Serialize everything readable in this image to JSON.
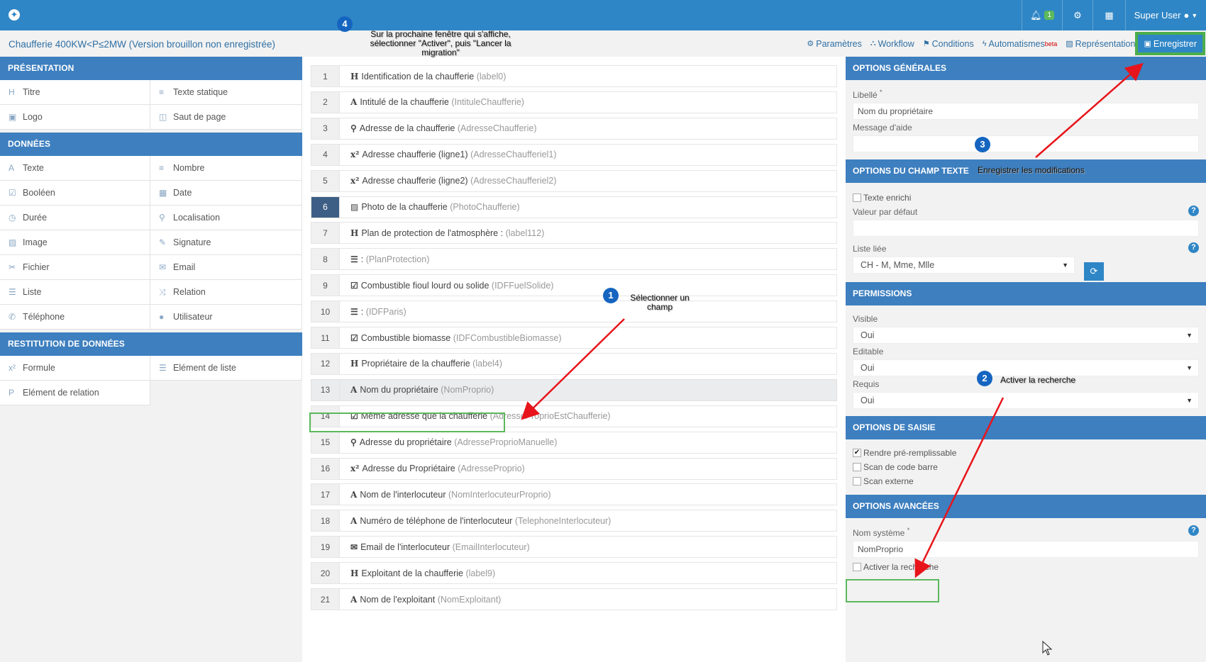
{
  "topbar": {
    "notification_count": "1",
    "user_label": "Super User"
  },
  "header": {
    "form_title": "Chaufferie 400KW<P≤2MW (Version brouillon non enregistrée)",
    "toolbar": {
      "parametres": "Paramètres",
      "workflow": "Workflow",
      "conditions": "Conditions",
      "automatismes": "Automatismes",
      "beta": "beta",
      "representation": "Représentation",
      "save": "Enregistrer"
    }
  },
  "left": {
    "presentation": {
      "title": "PRÉSENTATION",
      "items": [
        {
          "icon": "H",
          "label": "Titre"
        },
        {
          "icon": "≡",
          "label": "Texte statique"
        },
        {
          "icon": "▣",
          "label": "Logo"
        },
        {
          "icon": "◫",
          "label": "Saut de page"
        }
      ]
    },
    "donnees": {
      "title": "DONNÉES",
      "items": [
        {
          "icon": "A",
          "label": "Texte"
        },
        {
          "icon": "≡",
          "label": "Nombre"
        },
        {
          "icon": "☑",
          "label": "Booléen"
        },
        {
          "icon": "▦",
          "label": "Date"
        },
        {
          "icon": "◷",
          "label": "Durée"
        },
        {
          "icon": "⚲",
          "label": "Localisation"
        },
        {
          "icon": "▨",
          "label": "Image"
        },
        {
          "icon": "✎",
          "label": "Signature"
        },
        {
          "icon": "✂",
          "label": "Fichier"
        },
        {
          "icon": "✉",
          "label": "Email"
        },
        {
          "icon": "☰",
          "label": "Liste"
        },
        {
          "icon": "⤨",
          "label": "Relation"
        },
        {
          "icon": "✆",
          "label": "Téléphone"
        },
        {
          "icon": "●",
          "label": "Utilisateur"
        }
      ]
    },
    "restitution": {
      "title": "RESTITUTION DE DONNÉES",
      "items": [
        {
          "icon": "x²",
          "label": "Formule"
        },
        {
          "icon": "☰",
          "label": "Elément de liste"
        },
        {
          "icon": "P",
          "label": "Elément de relation"
        }
      ]
    }
  },
  "fields": [
    {
      "num": "1",
      "icon": "H",
      "label": "Identification de la chaufferie",
      "sys": "(label0)"
    },
    {
      "num": "2",
      "icon": "A",
      "label": "Intitulé de la chaufferie",
      "sys": "(IntituleChaufferie)"
    },
    {
      "num": "3",
      "icon": "⚲",
      "label": "Adresse de la chaufferie",
      "sys": "(AdresseChaufferie)"
    },
    {
      "num": "4",
      "icon": "x²",
      "label": "Adresse chaufferie (ligne1)",
      "sys": "(AdresseChaufferiel1)"
    },
    {
      "num": "5",
      "icon": "x²",
      "label": "Adresse chaufferie (ligne2)",
      "sys": "(AdresseChaufferiel2)"
    },
    {
      "num": "6",
      "icon": "▨",
      "label": "Photo de la chaufferie",
      "sys": "(PhotoChaufferie)"
    },
    {
      "num": "7",
      "icon": "H",
      "label": "Plan de protection de l'atmosphère :",
      "sys": "(label112)"
    },
    {
      "num": "8",
      "icon": "☰",
      "label": ":",
      "sys": "(PlanProtection)"
    },
    {
      "num": "9",
      "icon": "☑",
      "label": "Combustible fioul lourd ou solide",
      "sys": "(IDFFuelSolide)"
    },
    {
      "num": "10",
      "icon": "☰",
      "label": ":",
      "sys": "(IDFParis)"
    },
    {
      "num": "11",
      "icon": "☑",
      "label": "Combustible biomasse",
      "sys": "(IDFCombustibleBiomasse)"
    },
    {
      "num": "12",
      "icon": "H",
      "label": "Propriétaire de la chaufferie",
      "sys": "(label4)"
    },
    {
      "num": "13",
      "icon": "A",
      "label": "Nom du propriétaire",
      "sys": "(NomProprio)"
    },
    {
      "num": "14",
      "icon": "☑",
      "label": "Même adresse que la chaufferie",
      "sys": "(AdresseProprioEstChaufferie)"
    },
    {
      "num": "15",
      "icon": "⚲",
      "label": "Adresse du propriétaire",
      "sys": "(AdresseProprioManuelle)"
    },
    {
      "num": "16",
      "icon": "x²",
      "label": "Adresse du Propriétaire",
      "sys": "(AdresseProprio)"
    },
    {
      "num": "17",
      "icon": "A",
      "label": "Nom de l'interlocuteur",
      "sys": "(NomInterlocuteurProprio)"
    },
    {
      "num": "18",
      "icon": "A",
      "label": "Numéro de téléphone de l'interlocuteur",
      "sys": "(TelephoneInterlocuteur)"
    },
    {
      "num": "19",
      "icon": "✉",
      "label": "Email de l'interlocuteur",
      "sys": "(EmailInterlocuteur)"
    },
    {
      "num": "20",
      "icon": "H",
      "label": "Exploitant de la chaufferie",
      "sys": "(label9)"
    },
    {
      "num": "21",
      "icon": "A",
      "label": "Nom de l'exploitant",
      "sys": "(NomExploitant)"
    }
  ],
  "right": {
    "general": {
      "title": "OPTIONS GÉNÉRALES",
      "libelle_label": "Libellé",
      "required_mark": "*",
      "libelle_value": "Nom du propriétaire",
      "aide_label": "Message d'aide",
      "aide_value": ""
    },
    "champ_texte": {
      "title": "OPTIONS DU CHAMP TEXTE",
      "texte_enrichi": "Texte enrichi",
      "defaut_label": "Valeur par défaut",
      "liste_label": "Liste liée",
      "liste_value": "CH - M, Mme, Mlle"
    },
    "permissions": {
      "title": "PERMISSIONS",
      "visible_label": "Visible",
      "visible_value": "Oui",
      "editable_label": "Editable",
      "editable_value": "Oui",
      "requis_label": "Requis",
      "requis_value": "Oui"
    },
    "saisie": {
      "title": "OPTIONS DE SAISIE",
      "prerempli": "Rendre pré-remplissable",
      "code_barre": "Scan de code barre",
      "externe": "Scan externe"
    },
    "avancees": {
      "title": "OPTIONS AVANCÉES",
      "nom_label": "Nom système",
      "nom_value": "NomProprio",
      "recherche": "Activer la recherche"
    }
  },
  "annotations": {
    "n1": "1",
    "t1": "Sélectionner un champ",
    "n2": "2",
    "t2": "Activer la recherche",
    "n3": "3",
    "t3": "Enregistrer les modifications",
    "n4": "4",
    "t4": "Sur la prochaine fenêtre qui s'affiche, sélectionner \"Activer\", puis \"Lancer la migration\""
  },
  "colors": {
    "primary": "#2f86c6",
    "section_header": "#3d7fbf",
    "highlight_border": "#5cb85c",
    "arrow": "#e8141b"
  }
}
